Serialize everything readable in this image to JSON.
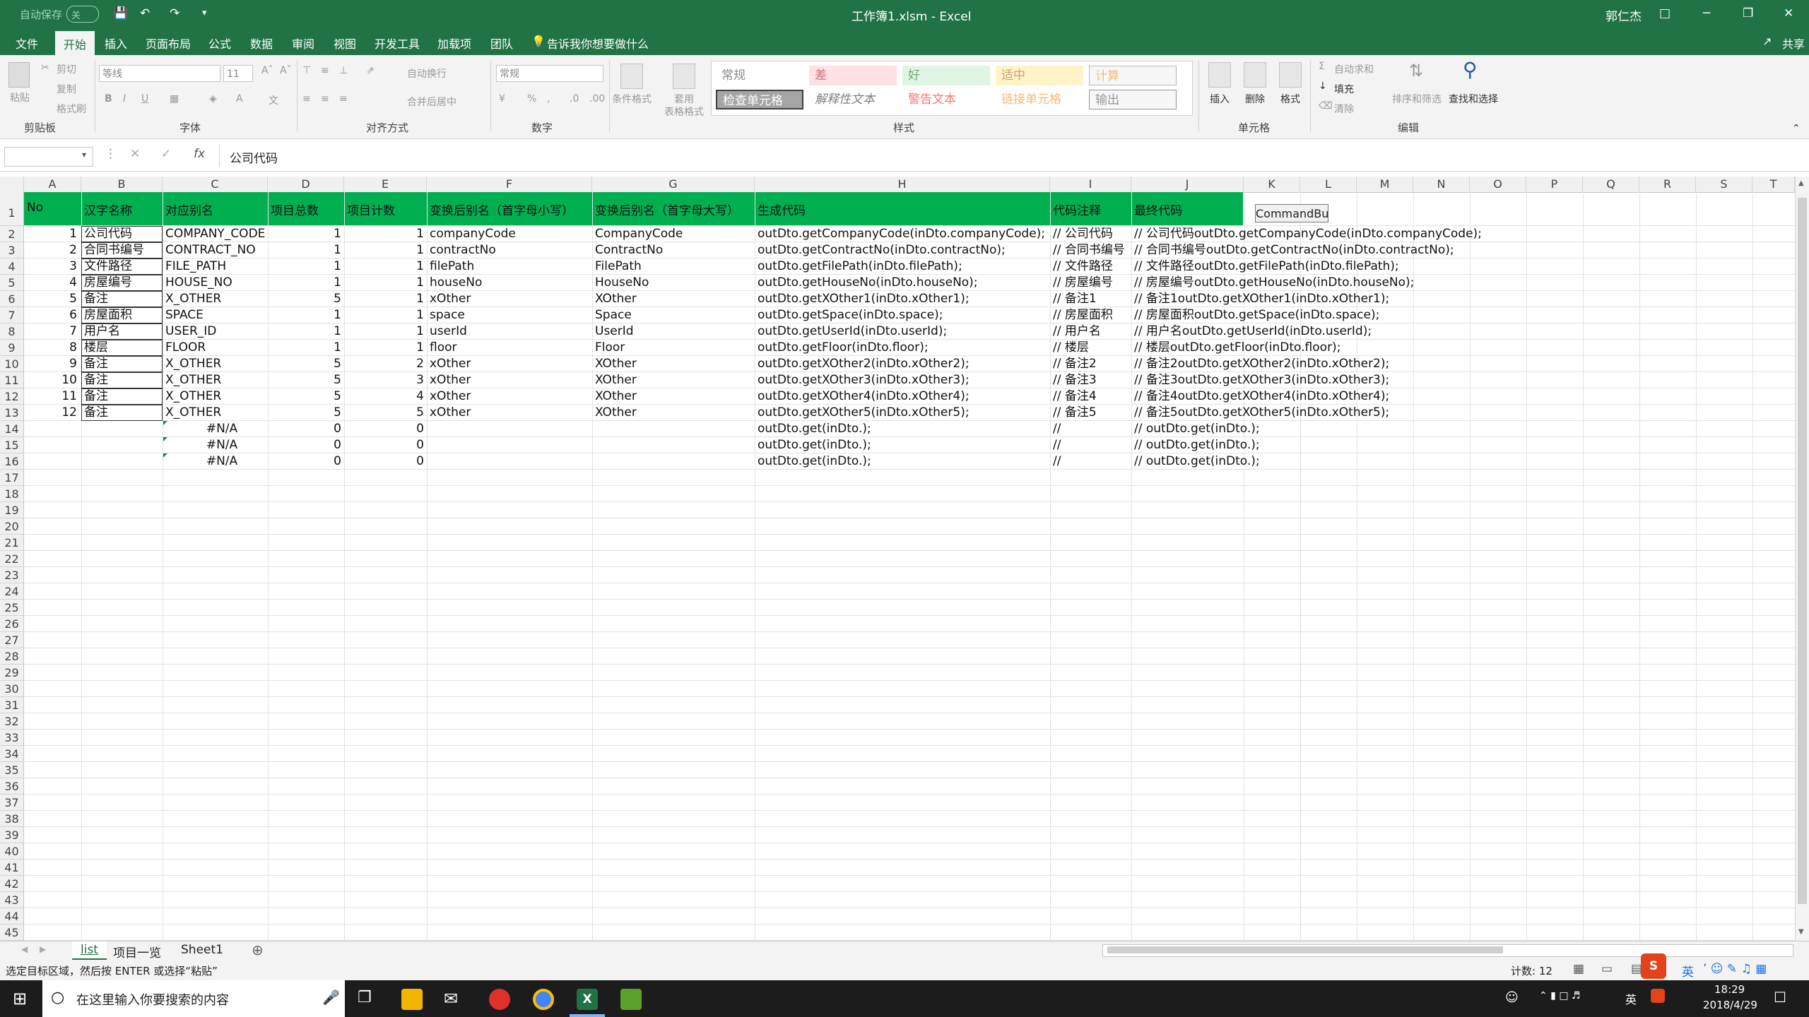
{
  "window": {
    "title": "工作簿1.xlsm - Excel",
    "autosave": "自动保存",
    "autosave_state": "关",
    "user": "郭仁杰",
    "controls": [
      "□",
      "─",
      "❐",
      "✕"
    ]
  },
  "menu": {
    "items": [
      "文件",
      "开始",
      "插入",
      "页面布局",
      "公式",
      "数据",
      "审阅",
      "视图",
      "开发工具",
      "加载项",
      "团队"
    ],
    "active": "开始",
    "tell_me": "告诉我你想要做什么",
    "share": "共享"
  },
  "ribbon": {
    "clipboard": {
      "label": "剪贴板",
      "paste": "粘贴",
      "cut": "剪切",
      "copy": "复制",
      "format_painter": "格式刷"
    },
    "font": {
      "label": "字体",
      "family": "等线",
      "size": "11",
      "bold": "B",
      "italic": "I",
      "underline": "U"
    },
    "alignment": {
      "label": "对齐方式",
      "wrap": "自动换行",
      "merge": "合并后居中"
    },
    "number": {
      "label": "数字",
      "format": "常规"
    },
    "styles": {
      "label": "样式",
      "conditional": "条件格式",
      "table_format_1": "套用",
      "table_format_2": "表格格式",
      "cells": [
        "常规",
        "差",
        "好",
        "适中",
        "计算",
        "检查单元格",
        "解释性文本",
        "警告文本",
        "链接单元格",
        "输出"
      ]
    },
    "cells": {
      "label": "单元格",
      "insert": "插入",
      "delete": "删除",
      "format": "格式"
    },
    "editing": {
      "label": "编辑",
      "autosum": "自动求和",
      "fill": "填充",
      "clear": "清除",
      "sort": "排序和筛选",
      "find": "查找和选择"
    }
  },
  "formula_bar": {
    "name_box": "",
    "fx": "fx",
    "value": "公司代码"
  },
  "columns": [
    "A",
    "B",
    "C",
    "D",
    "E",
    "F",
    "G",
    "H",
    "I",
    "J",
    "K",
    "L",
    "M",
    "N",
    "O",
    "P",
    "Q",
    "R",
    "S",
    "T"
  ],
  "sheet": {
    "header": [
      "No",
      "汉字名称",
      "对应别名",
      "项目总数",
      "项目计数",
      "变换后别名（首字母小写）",
      "变换后别名（首字母大写）",
      "生成代码",
      "代码注释",
      "最终代码"
    ],
    "button_label": "CommandBu",
    "rows": [
      {
        "a": "1",
        "b": "公司代码",
        "c": "COMPANY_CODE",
        "d": "1",
        "e": "1",
        "f": "companyCode",
        "g": "CompanyCode",
        "h": "outDto.getCompanyCode(inDto.companyCode);",
        "i": "// 公司代码",
        "j": "// 公司代码outDto.getCompanyCode(inDto.companyCode);"
      },
      {
        "a": "2",
        "b": "合同书编号",
        "c": "CONTRACT_NO",
        "d": "1",
        "e": "1",
        "f": "contractNo",
        "g": "ContractNo",
        "h": "outDto.getContractNo(inDto.contractNo);",
        "i": "// 合同书编号",
        "j": "// 合同书编号outDto.getContractNo(inDto.contractNo);"
      },
      {
        "a": "3",
        "b": "文件路径",
        "c": "FILE_PATH",
        "d": "1",
        "e": "1",
        "f": "filePath",
        "g": "FilePath",
        "h": "outDto.getFilePath(inDto.filePath);",
        "i": "// 文件路径",
        "j": "// 文件路径outDto.getFilePath(inDto.filePath);"
      },
      {
        "a": "4",
        "b": "房屋编号",
        "c": "HOUSE_NO",
        "d": "1",
        "e": "1",
        "f": "houseNo",
        "g": "HouseNo",
        "h": "outDto.getHouseNo(inDto.houseNo);",
        "i": "// 房屋编号",
        "j": "// 房屋编号outDto.getHouseNo(inDto.houseNo);"
      },
      {
        "a": "5",
        "b": "备注",
        "c": "X_OTHER",
        "d": "5",
        "e": "1",
        "f": "xOther",
        "g": "XOther",
        "h": "outDto.getXOther1(inDto.xOther1);",
        "i": "// 备注1",
        "j": "// 备注1outDto.getXOther1(inDto.xOther1);"
      },
      {
        "a": "6",
        "b": "房屋面积",
        "c": "SPACE",
        "d": "1",
        "e": "1",
        "f": "space",
        "g": "Space",
        "h": "outDto.getSpace(inDto.space);",
        "i": "// 房屋面积",
        "j": "// 房屋面积outDto.getSpace(inDto.space);"
      },
      {
        "a": "7",
        "b": "用户名",
        "c": "USER_ID",
        "d": "1",
        "e": "1",
        "f": "userId",
        "g": "UserId",
        "h": "outDto.getUserId(inDto.userId);",
        "i": "// 用户名",
        "j": "// 用户名outDto.getUserId(inDto.userId);"
      },
      {
        "a": "8",
        "b": "楼层",
        "c": "FLOOR",
        "d": "1",
        "e": "1",
        "f": "floor",
        "g": "Floor",
        "h": "outDto.getFloor(inDto.floor);",
        "i": "// 楼层",
        "j": "// 楼层outDto.getFloor(inDto.floor);"
      },
      {
        "a": "9",
        "b": "备注",
        "c": "X_OTHER",
        "d": "5",
        "e": "2",
        "f": "xOther",
        "g": "XOther",
        "h": "outDto.getXOther2(inDto.xOther2);",
        "i": "// 备注2",
        "j": "// 备注2outDto.getXOther2(inDto.xOther2);"
      },
      {
        "a": "10",
        "b": "备注",
        "c": "X_OTHER",
        "d": "5",
        "e": "3",
        "f": "xOther",
        "g": "XOther",
        "h": "outDto.getXOther3(inDto.xOther3);",
        "i": "// 备注3",
        "j": "// 备注3outDto.getXOther3(inDto.xOther3);"
      },
      {
        "a": "11",
        "b": "备注",
        "c": "X_OTHER",
        "d": "5",
        "e": "4",
        "f": "xOther",
        "g": "XOther",
        "h": "outDto.getXOther4(inDto.xOther4);",
        "i": "// 备注4",
        "j": "// 备注4outDto.getXOther4(inDto.xOther4);"
      },
      {
        "a": "12",
        "b": "备注",
        "c": "X_OTHER",
        "d": "5",
        "e": "5",
        "f": "xOther",
        "g": "XOther",
        "h": "outDto.getXOther5(inDto.xOther5);",
        "i": "// 备注5",
        "j": "// 备注5outDto.getXOther5(inDto.xOther5);"
      },
      {
        "a": "",
        "b": "",
        "c": "#N/A",
        "d": "0",
        "e": "0",
        "f": "",
        "g": "",
        "h": "outDto.get(inDto.);",
        "i": "//",
        "j": "// outDto.get(inDto.);"
      },
      {
        "a": "",
        "b": "",
        "c": "#N/A",
        "d": "0",
        "e": "0",
        "f": "",
        "g": "",
        "h": "outDto.get(inDto.);",
        "i": "//",
        "j": "// outDto.get(inDto.);"
      },
      {
        "a": "",
        "b": "",
        "c": "#N/A",
        "d": "0",
        "e": "0",
        "f": "",
        "g": "",
        "h": "outDto.get(inDto.);",
        "i": "//",
        "j": "// outDto.get(inDto.);"
      }
    ]
  },
  "sheet_tabs": [
    "list",
    "项目一览",
    "Sheet1"
  ],
  "active_sheet": "list",
  "status": {
    "message": "选定目标区域，然后按 ENTER 或选择“粘贴”",
    "count": "计数: 12"
  },
  "taskbar": {
    "search_placeholder": "在这里输入你要搜索的内容",
    "time": "18:29",
    "date": "2018/4/29",
    "ime": "英"
  },
  "colors": {
    "excel_green": "#217346",
    "header_fill": "#00b050",
    "taskbar": "#1c1c1c"
  }
}
